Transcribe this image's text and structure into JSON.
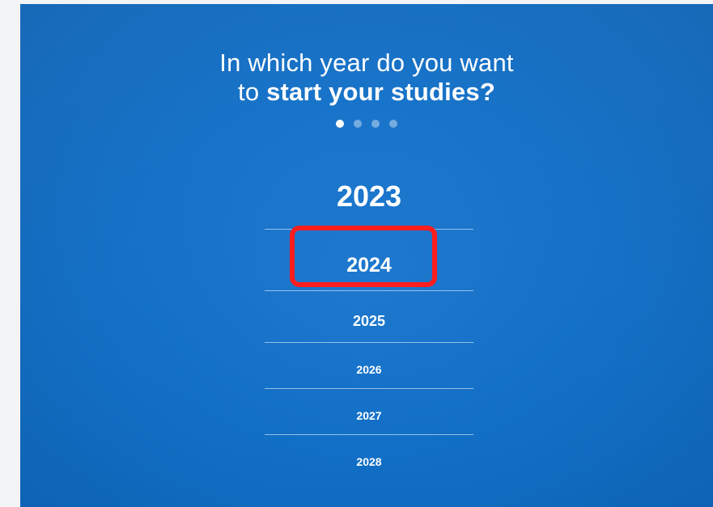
{
  "question": {
    "line1": "In which year do you want",
    "line2_prefix": "to ",
    "line2_bold": "start your studies?"
  },
  "progress": {
    "total_steps": 4,
    "current_step": 1
  },
  "years": {
    "top": "2023",
    "selected": "2024",
    "y2025": "2025",
    "y2026": "2026",
    "y2027": "2027",
    "y2028": "2028"
  },
  "colors": {
    "background": "#1170c9",
    "text": "#ffffff",
    "highlight": "#ff1d1d"
  }
}
